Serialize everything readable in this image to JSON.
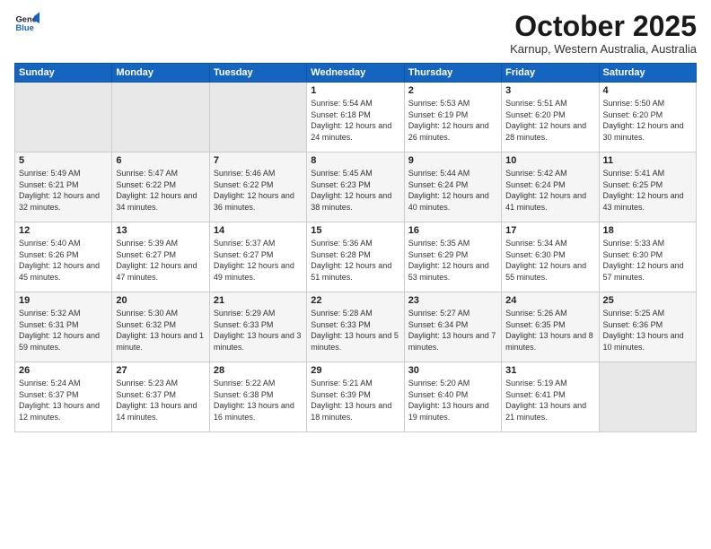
{
  "logo": {
    "line1": "General",
    "line2": "Blue"
  },
  "title": "October 2025",
  "location": "Karnup, Western Australia, Australia",
  "weekdays": [
    "Sunday",
    "Monday",
    "Tuesday",
    "Wednesday",
    "Thursday",
    "Friday",
    "Saturday"
  ],
  "weeks": [
    [
      {
        "day": "",
        "sunrise": "",
        "sunset": "",
        "daylight": ""
      },
      {
        "day": "",
        "sunrise": "",
        "sunset": "",
        "daylight": ""
      },
      {
        "day": "",
        "sunrise": "",
        "sunset": "",
        "daylight": ""
      },
      {
        "day": "1",
        "sunrise": "Sunrise: 5:54 AM",
        "sunset": "Sunset: 6:18 PM",
        "daylight": "Daylight: 12 hours and 24 minutes."
      },
      {
        "day": "2",
        "sunrise": "Sunrise: 5:53 AM",
        "sunset": "Sunset: 6:19 PM",
        "daylight": "Daylight: 12 hours and 26 minutes."
      },
      {
        "day": "3",
        "sunrise": "Sunrise: 5:51 AM",
        "sunset": "Sunset: 6:20 PM",
        "daylight": "Daylight: 12 hours and 28 minutes."
      },
      {
        "day": "4",
        "sunrise": "Sunrise: 5:50 AM",
        "sunset": "Sunset: 6:20 PM",
        "daylight": "Daylight: 12 hours and 30 minutes."
      }
    ],
    [
      {
        "day": "5",
        "sunrise": "Sunrise: 5:49 AM",
        "sunset": "Sunset: 6:21 PM",
        "daylight": "Daylight: 12 hours and 32 minutes."
      },
      {
        "day": "6",
        "sunrise": "Sunrise: 5:47 AM",
        "sunset": "Sunset: 6:22 PM",
        "daylight": "Daylight: 12 hours and 34 minutes."
      },
      {
        "day": "7",
        "sunrise": "Sunrise: 5:46 AM",
        "sunset": "Sunset: 6:22 PM",
        "daylight": "Daylight: 12 hours and 36 minutes."
      },
      {
        "day": "8",
        "sunrise": "Sunrise: 5:45 AM",
        "sunset": "Sunset: 6:23 PM",
        "daylight": "Daylight: 12 hours and 38 minutes."
      },
      {
        "day": "9",
        "sunrise": "Sunrise: 5:44 AM",
        "sunset": "Sunset: 6:24 PM",
        "daylight": "Daylight: 12 hours and 40 minutes."
      },
      {
        "day": "10",
        "sunrise": "Sunrise: 5:42 AM",
        "sunset": "Sunset: 6:24 PM",
        "daylight": "Daylight: 12 hours and 41 minutes."
      },
      {
        "day": "11",
        "sunrise": "Sunrise: 5:41 AM",
        "sunset": "Sunset: 6:25 PM",
        "daylight": "Daylight: 12 hours and 43 minutes."
      }
    ],
    [
      {
        "day": "12",
        "sunrise": "Sunrise: 5:40 AM",
        "sunset": "Sunset: 6:26 PM",
        "daylight": "Daylight: 12 hours and 45 minutes."
      },
      {
        "day": "13",
        "sunrise": "Sunrise: 5:39 AM",
        "sunset": "Sunset: 6:27 PM",
        "daylight": "Daylight: 12 hours and 47 minutes."
      },
      {
        "day": "14",
        "sunrise": "Sunrise: 5:37 AM",
        "sunset": "Sunset: 6:27 PM",
        "daylight": "Daylight: 12 hours and 49 minutes."
      },
      {
        "day": "15",
        "sunrise": "Sunrise: 5:36 AM",
        "sunset": "Sunset: 6:28 PM",
        "daylight": "Daylight: 12 hours and 51 minutes."
      },
      {
        "day": "16",
        "sunrise": "Sunrise: 5:35 AM",
        "sunset": "Sunset: 6:29 PM",
        "daylight": "Daylight: 12 hours and 53 minutes."
      },
      {
        "day": "17",
        "sunrise": "Sunrise: 5:34 AM",
        "sunset": "Sunset: 6:30 PM",
        "daylight": "Daylight: 12 hours and 55 minutes."
      },
      {
        "day": "18",
        "sunrise": "Sunrise: 5:33 AM",
        "sunset": "Sunset: 6:30 PM",
        "daylight": "Daylight: 12 hours and 57 minutes."
      }
    ],
    [
      {
        "day": "19",
        "sunrise": "Sunrise: 5:32 AM",
        "sunset": "Sunset: 6:31 PM",
        "daylight": "Daylight: 12 hours and 59 minutes."
      },
      {
        "day": "20",
        "sunrise": "Sunrise: 5:30 AM",
        "sunset": "Sunset: 6:32 PM",
        "daylight": "Daylight: 13 hours and 1 minute."
      },
      {
        "day": "21",
        "sunrise": "Sunrise: 5:29 AM",
        "sunset": "Sunset: 6:33 PM",
        "daylight": "Daylight: 13 hours and 3 minutes."
      },
      {
        "day": "22",
        "sunrise": "Sunrise: 5:28 AM",
        "sunset": "Sunset: 6:33 PM",
        "daylight": "Daylight: 13 hours and 5 minutes."
      },
      {
        "day": "23",
        "sunrise": "Sunrise: 5:27 AM",
        "sunset": "Sunset: 6:34 PM",
        "daylight": "Daylight: 13 hours and 7 minutes."
      },
      {
        "day": "24",
        "sunrise": "Sunrise: 5:26 AM",
        "sunset": "Sunset: 6:35 PM",
        "daylight": "Daylight: 13 hours and 8 minutes."
      },
      {
        "day": "25",
        "sunrise": "Sunrise: 5:25 AM",
        "sunset": "Sunset: 6:36 PM",
        "daylight": "Daylight: 13 hours and 10 minutes."
      }
    ],
    [
      {
        "day": "26",
        "sunrise": "Sunrise: 5:24 AM",
        "sunset": "Sunset: 6:37 PM",
        "daylight": "Daylight: 13 hours and 12 minutes."
      },
      {
        "day": "27",
        "sunrise": "Sunrise: 5:23 AM",
        "sunset": "Sunset: 6:37 PM",
        "daylight": "Daylight: 13 hours and 14 minutes."
      },
      {
        "day": "28",
        "sunrise": "Sunrise: 5:22 AM",
        "sunset": "Sunset: 6:38 PM",
        "daylight": "Daylight: 13 hours and 16 minutes."
      },
      {
        "day": "29",
        "sunrise": "Sunrise: 5:21 AM",
        "sunset": "Sunset: 6:39 PM",
        "daylight": "Daylight: 13 hours and 18 minutes."
      },
      {
        "day": "30",
        "sunrise": "Sunrise: 5:20 AM",
        "sunset": "Sunset: 6:40 PM",
        "daylight": "Daylight: 13 hours and 19 minutes."
      },
      {
        "day": "31",
        "sunrise": "Sunrise: 5:19 AM",
        "sunset": "Sunset: 6:41 PM",
        "daylight": "Daylight: 13 hours and 21 minutes."
      },
      {
        "day": "",
        "sunrise": "",
        "sunset": "",
        "daylight": ""
      }
    ]
  ]
}
